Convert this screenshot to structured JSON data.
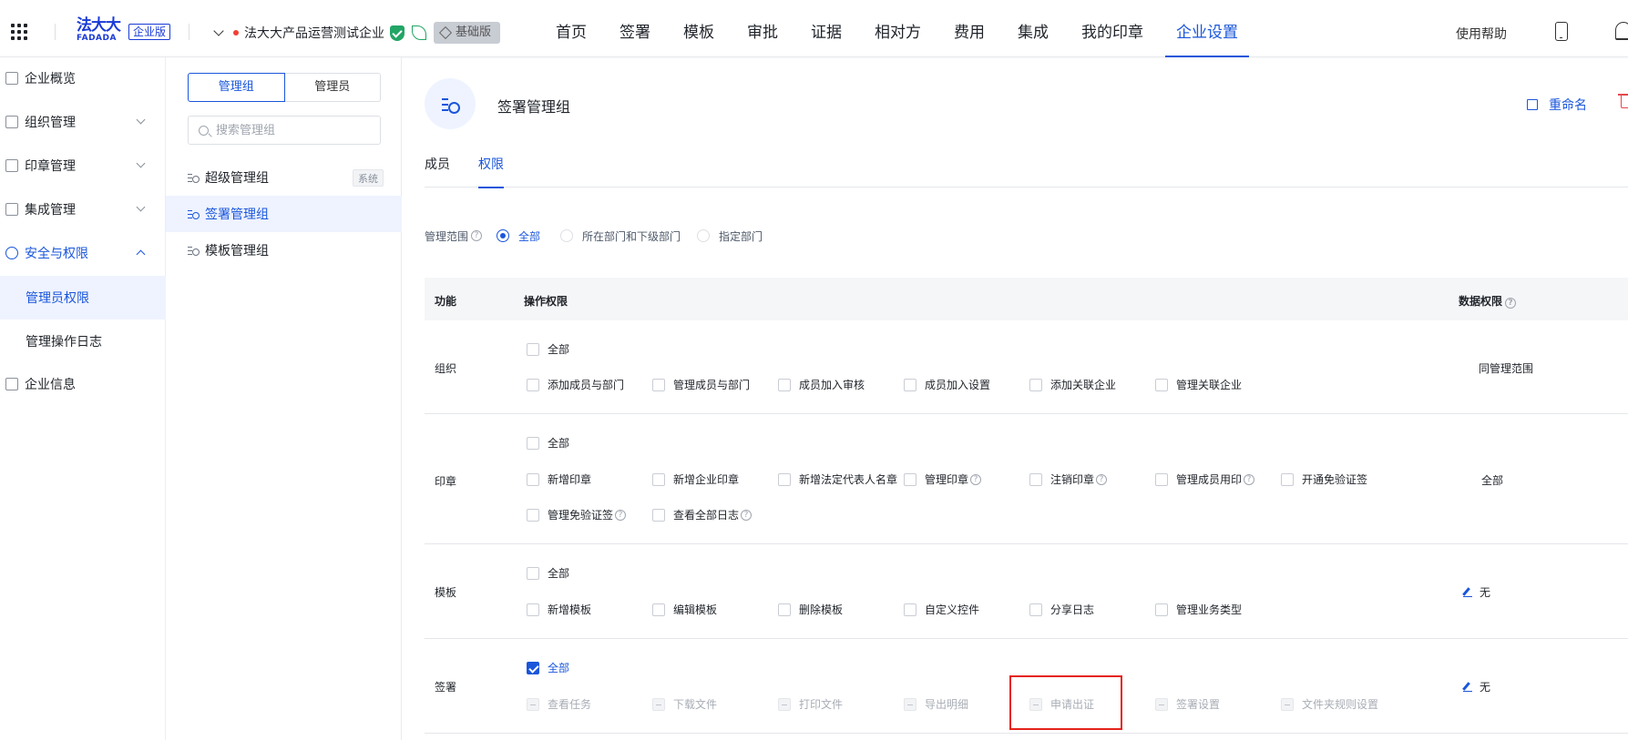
{
  "topbar": {
    "logo_main": "法大大",
    "logo_sub": "FADADA",
    "edition_badge": "企业版",
    "company_name": "法大大产品运营测试企业",
    "plan_label": "基础版",
    "help_label": "使用帮助",
    "nav": [
      {
        "label": "首页"
      },
      {
        "label": "签署"
      },
      {
        "label": "模板"
      },
      {
        "label": "审批"
      },
      {
        "label": "证据"
      },
      {
        "label": "相对方"
      },
      {
        "label": "费用"
      },
      {
        "label": "集成"
      },
      {
        "label": "我的印章"
      },
      {
        "label": "企业设置",
        "active": true
      }
    ]
  },
  "sidebar": {
    "items": [
      {
        "label": "企业概览"
      },
      {
        "label": "组织管理"
      },
      {
        "label": "印章管理"
      },
      {
        "label": "集成管理"
      },
      {
        "label": "安全与权限"
      },
      {
        "label": "管理员权限",
        "active": true
      },
      {
        "label": "管理操作日志"
      },
      {
        "label": "企业信息"
      }
    ]
  },
  "group_panel": {
    "segments": [
      "管理组",
      "管理员"
    ],
    "search_placeholder": "搜索管理组",
    "groups": [
      {
        "label": "超级管理组",
        "tag": "系统"
      },
      {
        "label": "签署管理组",
        "active": true
      },
      {
        "label": "模板管理组"
      }
    ]
  },
  "main": {
    "title": "签署管理组",
    "rename_label": "重命名",
    "tabs": [
      "成员",
      "权限"
    ],
    "active_tab": "权限",
    "scope": {
      "label": "管理范围",
      "options": [
        "全部",
        "所在部门和下级部门",
        "指定部门"
      ],
      "selected": "全部"
    },
    "table": {
      "headers": {
        "function": "功能",
        "operation": "操作权限",
        "data": "数据权限"
      },
      "rows": [
        {
          "name": "组织",
          "all_label": "全部",
          "data_perm": "同管理范围",
          "perms": [
            "添加成员与部门",
            "管理成员与部门",
            "成员加入审核",
            "成员加入设置",
            "添加关联企业",
            "管理关联企业"
          ]
        },
        {
          "name": "印章",
          "all_label": "全部",
          "data_perm": "全部",
          "perms": [
            "新增印章",
            "新增企业印章",
            "新增法定代表人名章",
            "管理印章",
            "注销印章",
            "管理成员用印",
            "开通免验证签",
            "管理免验证签",
            "查看全部日志"
          ]
        },
        {
          "name": "模板",
          "all_label": "全部",
          "data_perm": "无",
          "perms": [
            "新增模板",
            "编辑模板",
            "删除模板",
            "自定义控件",
            "分享日志",
            "管理业务类型"
          ]
        },
        {
          "name": "签署",
          "all_label": "全部",
          "all_checked": true,
          "data_perm": "无",
          "perms": [
            "查看任务",
            "下载文件",
            "打印文件",
            "导出明细",
            "申请出证",
            "签署设置",
            "文件夹规则设置"
          ]
        }
      ]
    }
  },
  "colors": {
    "accent": "#1a56db",
    "highlight": "#e5231b",
    "selected_bg": "#eef3ff"
  }
}
